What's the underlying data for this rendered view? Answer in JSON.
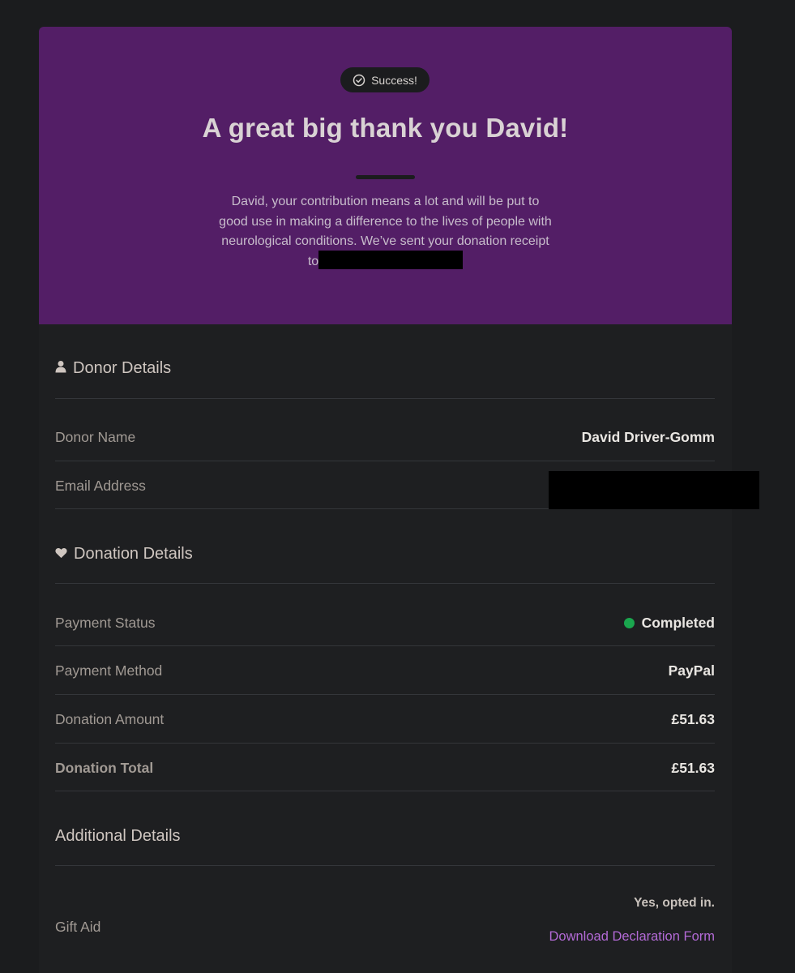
{
  "hero": {
    "badge_label": "Success!",
    "badge_icon": "check-circle-icon",
    "title": "A great big thank you David!",
    "message": "David, your contribution means a lot and will be put to good use in making a difference to the lives of people with neurological conditions. We’ve sent your donation receipt to",
    "background_color": "#531e66"
  },
  "donor_details": {
    "heading": "Donor Details",
    "heading_icon": "user-icon",
    "rows": [
      {
        "label": "Donor Name",
        "value": "David Driver-Gomm"
      },
      {
        "label": "Email Address",
        "value": ""
      }
    ]
  },
  "donation_details": {
    "heading": "Donation Details",
    "heading_icon": "heart-icon",
    "rows": [
      {
        "label": "Payment Status",
        "value": "Completed",
        "status_color": "#1aa64e"
      },
      {
        "label": "Payment Method",
        "value": "PayPal"
      },
      {
        "label": "Donation Amount",
        "value": "£51.63"
      },
      {
        "label": "Donation Total",
        "value": "£51.63"
      }
    ]
  },
  "additional_details": {
    "heading": "Additional Details",
    "gift_aid": {
      "label": "Gift Aid",
      "value": "Yes, opted in.",
      "link_label": "Download Declaration Form",
      "link_color": "#b36ad6"
    }
  }
}
